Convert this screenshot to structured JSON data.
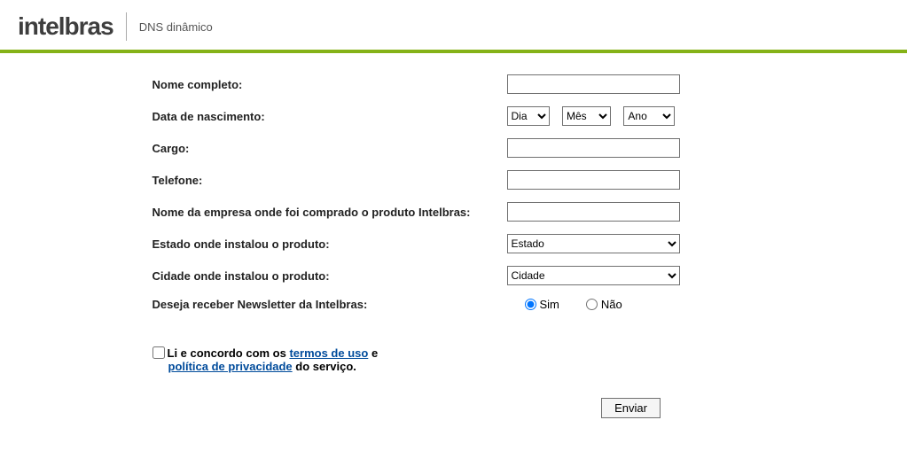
{
  "header": {
    "logo_text": "intelbras",
    "subtitle": "DNS dinâmico"
  },
  "form": {
    "nome_label": "Nome completo:",
    "nome_value": "",
    "nascimento_label": "Data de nascimento:",
    "dia_option": "Dia",
    "mes_option": "Mês",
    "ano_option": "Ano",
    "cargo_label": "Cargo:",
    "cargo_value": "",
    "telefone_label": "Telefone:",
    "telefone_value": "",
    "empresa_label": "Nome da empresa onde foi comprado o produto Intelbras:",
    "empresa_value": "",
    "estado_label": "Estado onde instalou o produto:",
    "estado_option": "Estado",
    "cidade_label": "Cidade onde instalou o produto:",
    "cidade_option": "Cidade",
    "newsletter_label": "Deseja receber Newsletter da Intelbras:",
    "newsletter_sim": "Sim",
    "newsletter_nao": "Não",
    "terms_prefix": "Li e concordo com os ",
    "terms_link": "termos de uso",
    "terms_and": " e ",
    "privacy_link": "política de privacidade",
    "terms_suffix": " do serviço.",
    "submit_label": "Enviar"
  }
}
